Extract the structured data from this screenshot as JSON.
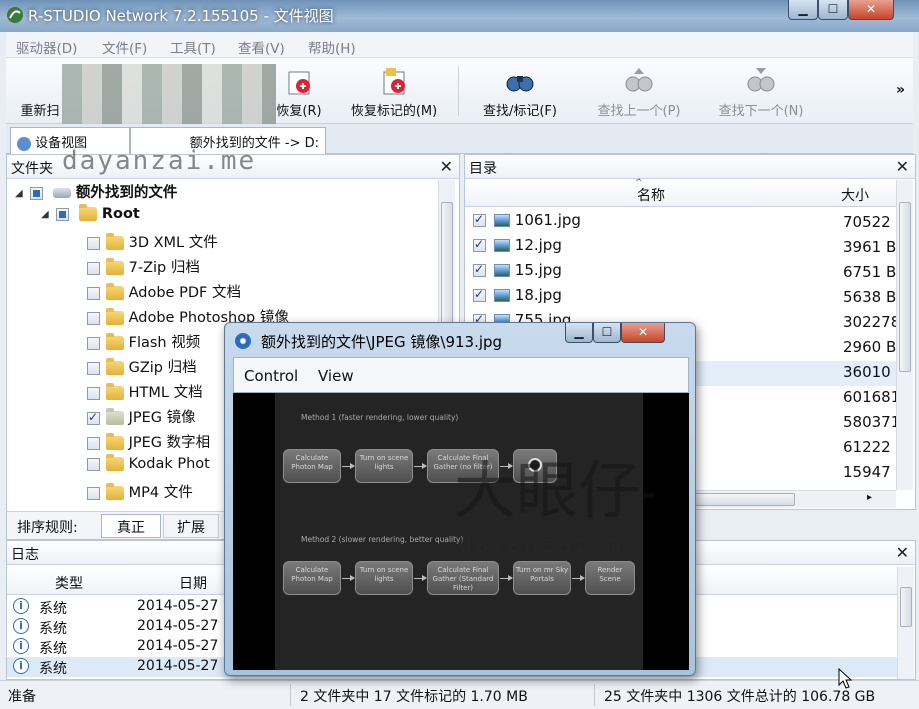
{
  "window": {
    "title": "R-STUDIO Network 7.2.155105 - 文件视图",
    "icon": "r-studio-app-icon"
  },
  "menu": [
    "驱动器(D)",
    "文件(F)",
    "工具(T)",
    "查看(V)",
    "帮助(H)"
  ],
  "toolbar": {
    "rescan": "重新扫",
    "recover": "恢复(R)",
    "recover_marked": "恢复标记的(M)",
    "find_mark": "查找/标记(F)",
    "find_prev": "查找上一个(P)",
    "find_next": "查找下一个(N)",
    "more": "»"
  },
  "tabs": {
    "device_view": "设备视图",
    "file_view_path": "额外找到的文件 -> D:"
  },
  "folders_pane": {
    "title": "文件夹",
    "root_label": "额外找到的文件",
    "root_child": "Root",
    "items": [
      {
        "label": "3D XML 文件",
        "checked": false
      },
      {
        "label": "7-Zip 归档",
        "checked": false
      },
      {
        "label": "Adobe PDF 文档",
        "checked": false
      },
      {
        "label": "Adobe Photoshop 镜像",
        "checked": false
      },
      {
        "label": "Flash 视频",
        "checked": false
      },
      {
        "label": "GZip 归档",
        "checked": false
      },
      {
        "label": "HTML 文档",
        "checked": false
      },
      {
        "label": "JPEG 镜像",
        "checked": true
      },
      {
        "label": "JPEG 数字相",
        "checked": false
      },
      {
        "label": "Kodak Phot",
        "checked": false
      },
      {
        "label": "MP4 文件",
        "checked": false
      }
    ],
    "sort_label": "排序规则:",
    "sort_tabs": [
      "真正",
      "扩展"
    ]
  },
  "contents_pane": {
    "title": "目录",
    "col_name": "名称",
    "col_size": "大小",
    "rows": [
      {
        "name": "1061.jpg",
        "size": "70522",
        "checked": true
      },
      {
        "name": "12.jpg",
        "size": "3961 B",
        "checked": true
      },
      {
        "name": "15.jpg",
        "size": "6751 B",
        "checked": true
      },
      {
        "name": "18.jpg",
        "size": "5638 B",
        "checked": true
      },
      {
        "name": "755.jpg",
        "size": "302278",
        "checked": true
      },
      {
        "name": "",
        "size": "2960 B",
        "checked": true
      },
      {
        "name": "",
        "size": "36010",
        "checked": true
      },
      {
        "name": "",
        "size": "601681",
        "checked": true
      },
      {
        "name": "",
        "size": "580371",
        "checked": true
      },
      {
        "name": "",
        "size": "61222",
        "checked": true
      },
      {
        "name": "",
        "size": "15947",
        "checked": true
      }
    ]
  },
  "log_pane": {
    "title": "日志",
    "col_type": "类型",
    "col_date": "日期",
    "rows": [
      {
        "type": "系统",
        "date": "2014-05-27"
      },
      {
        "type": "系统",
        "date": "2014-05-27"
      },
      {
        "type": "系统",
        "date": "2014-05-27"
      },
      {
        "type": "系统",
        "date": "2014-05-27"
      }
    ]
  },
  "status": {
    "ready": "准备",
    "marked": "2 文件夹中 17 文件标记的 1.70 MB",
    "total": "25 文件夹中 1306 文件总计的 106.78 GB"
  },
  "preview": {
    "title": "额外找到的文件\\JPEG 镜像\\913.jpg",
    "menu": [
      "Control",
      "View"
    ],
    "method1": "Method 1 (faster rendering, lower quality)",
    "method2": "Method 2 (slower rendering, better quality)",
    "m1_nodes": [
      "Calculate Photon Map",
      "Turn on scene lights",
      "Calculate Final Gather (no filter)"
    ],
    "m2_nodes": [
      "Calculate Photon Map",
      "Turn on scene lights",
      "Calculate Final Gather (Standard Filter)",
      "Turn on mr Sky Portals",
      "Render Scene"
    ]
  },
  "watermarks": {
    "top": "dayanzai.me",
    "middle": "dayanzai.m",
    "big": "大眼仔-"
  },
  "colors": {
    "title_bar": "#8aa8c8",
    "selection": "#cfe3f8",
    "accent": "#2f6bbd"
  }
}
